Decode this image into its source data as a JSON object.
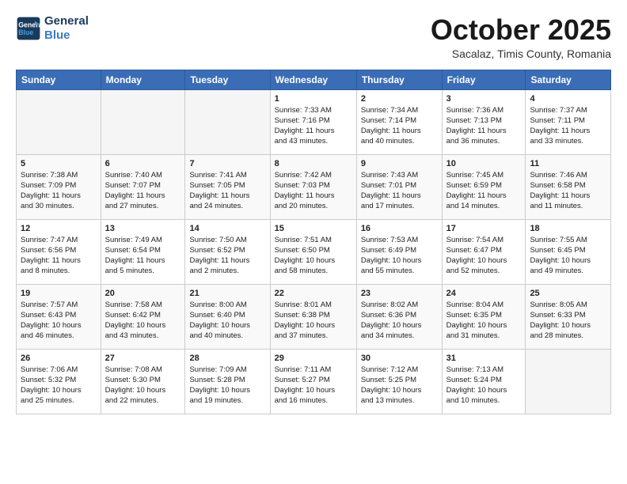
{
  "header": {
    "logo_line1": "General",
    "logo_line2": "Blue",
    "month": "October 2025",
    "location": "Sacalaz, Timis County, Romania"
  },
  "weekdays": [
    "Sunday",
    "Monday",
    "Tuesday",
    "Wednesday",
    "Thursday",
    "Friday",
    "Saturday"
  ],
  "weeks": [
    [
      {
        "day": "",
        "info": ""
      },
      {
        "day": "",
        "info": ""
      },
      {
        "day": "",
        "info": ""
      },
      {
        "day": "1",
        "info": "Sunrise: 7:33 AM\nSunset: 7:16 PM\nDaylight: 11 hours\nand 43 minutes."
      },
      {
        "day": "2",
        "info": "Sunrise: 7:34 AM\nSunset: 7:14 PM\nDaylight: 11 hours\nand 40 minutes."
      },
      {
        "day": "3",
        "info": "Sunrise: 7:36 AM\nSunset: 7:13 PM\nDaylight: 11 hours\nand 36 minutes."
      },
      {
        "day": "4",
        "info": "Sunrise: 7:37 AM\nSunset: 7:11 PM\nDaylight: 11 hours\nand 33 minutes."
      }
    ],
    [
      {
        "day": "5",
        "info": "Sunrise: 7:38 AM\nSunset: 7:09 PM\nDaylight: 11 hours\nand 30 minutes."
      },
      {
        "day": "6",
        "info": "Sunrise: 7:40 AM\nSunset: 7:07 PM\nDaylight: 11 hours\nand 27 minutes."
      },
      {
        "day": "7",
        "info": "Sunrise: 7:41 AM\nSunset: 7:05 PM\nDaylight: 11 hours\nand 24 minutes."
      },
      {
        "day": "8",
        "info": "Sunrise: 7:42 AM\nSunset: 7:03 PM\nDaylight: 11 hours\nand 20 minutes."
      },
      {
        "day": "9",
        "info": "Sunrise: 7:43 AM\nSunset: 7:01 PM\nDaylight: 11 hours\nand 17 minutes."
      },
      {
        "day": "10",
        "info": "Sunrise: 7:45 AM\nSunset: 6:59 PM\nDaylight: 11 hours\nand 14 minutes."
      },
      {
        "day": "11",
        "info": "Sunrise: 7:46 AM\nSunset: 6:58 PM\nDaylight: 11 hours\nand 11 minutes."
      }
    ],
    [
      {
        "day": "12",
        "info": "Sunrise: 7:47 AM\nSunset: 6:56 PM\nDaylight: 11 hours\nand 8 minutes."
      },
      {
        "day": "13",
        "info": "Sunrise: 7:49 AM\nSunset: 6:54 PM\nDaylight: 11 hours\nand 5 minutes."
      },
      {
        "day": "14",
        "info": "Sunrise: 7:50 AM\nSunset: 6:52 PM\nDaylight: 11 hours\nand 2 minutes."
      },
      {
        "day": "15",
        "info": "Sunrise: 7:51 AM\nSunset: 6:50 PM\nDaylight: 10 hours\nand 58 minutes."
      },
      {
        "day": "16",
        "info": "Sunrise: 7:53 AM\nSunset: 6:49 PM\nDaylight: 10 hours\nand 55 minutes."
      },
      {
        "day": "17",
        "info": "Sunrise: 7:54 AM\nSunset: 6:47 PM\nDaylight: 10 hours\nand 52 minutes."
      },
      {
        "day": "18",
        "info": "Sunrise: 7:55 AM\nSunset: 6:45 PM\nDaylight: 10 hours\nand 49 minutes."
      }
    ],
    [
      {
        "day": "19",
        "info": "Sunrise: 7:57 AM\nSunset: 6:43 PM\nDaylight: 10 hours\nand 46 minutes."
      },
      {
        "day": "20",
        "info": "Sunrise: 7:58 AM\nSunset: 6:42 PM\nDaylight: 10 hours\nand 43 minutes."
      },
      {
        "day": "21",
        "info": "Sunrise: 8:00 AM\nSunset: 6:40 PM\nDaylight: 10 hours\nand 40 minutes."
      },
      {
        "day": "22",
        "info": "Sunrise: 8:01 AM\nSunset: 6:38 PM\nDaylight: 10 hours\nand 37 minutes."
      },
      {
        "day": "23",
        "info": "Sunrise: 8:02 AM\nSunset: 6:36 PM\nDaylight: 10 hours\nand 34 minutes."
      },
      {
        "day": "24",
        "info": "Sunrise: 8:04 AM\nSunset: 6:35 PM\nDaylight: 10 hours\nand 31 minutes."
      },
      {
        "day": "25",
        "info": "Sunrise: 8:05 AM\nSunset: 6:33 PM\nDaylight: 10 hours\nand 28 minutes."
      }
    ],
    [
      {
        "day": "26",
        "info": "Sunrise: 7:06 AM\nSunset: 5:32 PM\nDaylight: 10 hours\nand 25 minutes."
      },
      {
        "day": "27",
        "info": "Sunrise: 7:08 AM\nSunset: 5:30 PM\nDaylight: 10 hours\nand 22 minutes."
      },
      {
        "day": "28",
        "info": "Sunrise: 7:09 AM\nSunset: 5:28 PM\nDaylight: 10 hours\nand 19 minutes."
      },
      {
        "day": "29",
        "info": "Sunrise: 7:11 AM\nSunset: 5:27 PM\nDaylight: 10 hours\nand 16 minutes."
      },
      {
        "day": "30",
        "info": "Sunrise: 7:12 AM\nSunset: 5:25 PM\nDaylight: 10 hours\nand 13 minutes."
      },
      {
        "day": "31",
        "info": "Sunrise: 7:13 AM\nSunset: 5:24 PM\nDaylight: 10 hours\nand 10 minutes."
      },
      {
        "day": "",
        "info": ""
      }
    ]
  ]
}
